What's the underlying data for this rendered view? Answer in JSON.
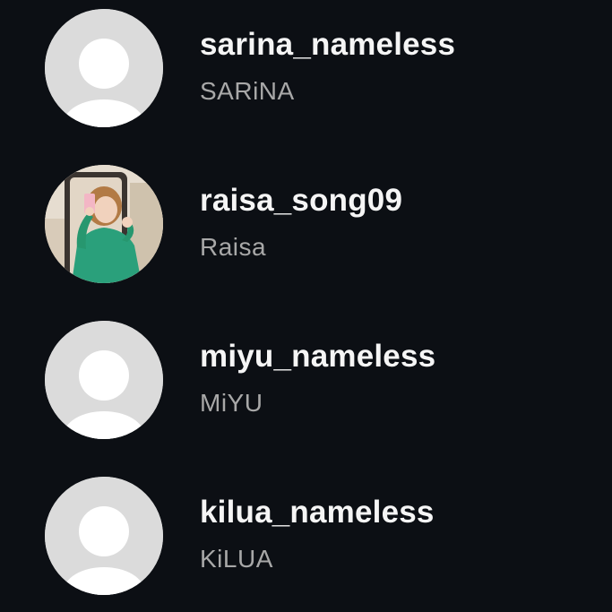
{
  "accounts": [
    {
      "username": "sarina_nameless",
      "full_name": "SARiNA",
      "avatar": "default-avatar-icon"
    },
    {
      "username": "raisa_song09",
      "full_name": "Raisa",
      "avatar": "profile-photo"
    },
    {
      "username": "miyu_nameless",
      "full_name": "MiYU",
      "avatar": "default-avatar-icon"
    },
    {
      "username": "kilua_nameless",
      "full_name": "KiLUA",
      "avatar": "default-avatar-icon"
    }
  ],
  "colors": {
    "background": "#0c0f14",
    "username": "#f5f5f5",
    "full_name": "#a8a8a8",
    "default_avatar_bg": "#dbdbdb",
    "default_avatar_figure": "#ffffff"
  }
}
